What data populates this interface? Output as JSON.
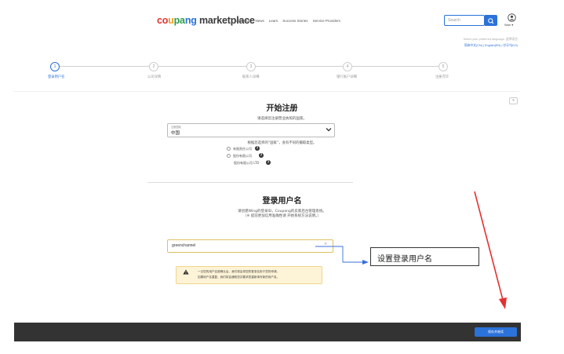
{
  "header": {
    "logo": {
      "c1": "co",
      "c2": "u",
      "c3": "pa",
      "c4": "ng",
      "rest": " marketplace"
    },
    "nav": [
      "About Us",
      "News",
      "Learn",
      "Success Stories",
      "Service Providers"
    ],
    "search_placeholder": "Search",
    "user_label": "Wan ▾",
    "lang_note": "Select your preferred language. 选择语言",
    "lang_links": "简体中文(CN) | English(EN) | 한국어(KO)"
  },
  "stepper": {
    "steps": [
      {
        "num": "1",
        "label": "登录用户名",
        "active": true
      },
      {
        "num": "2",
        "label": "公司详情",
        "active": false
      },
      {
        "num": "3",
        "label": "联系人详细",
        "active": false
      },
      {
        "num": "4",
        "label": "银行账户详细",
        "active": false
      },
      {
        "num": "5",
        "label": "注册完毕",
        "active": false
      }
    ]
  },
  "collapse": "»",
  "start": {
    "title": "开始注册",
    "subtitle": "请选择您注册营业执照的国家。",
    "country_label": "注册国家",
    "country_value": "中国",
    "biz_note": "根据您选择的“国家”，会有不同的摄取类型。",
    "options": [
      "有限责任公司",
      "股份有限公司",
      "股份有限公司 LTD"
    ]
  },
  "login": {
    "title": "登录用户名",
    "sub1": "请创建Wing的登录ID，Coupang的卖家后台管理系统。",
    "sub2": "（※ 提前更加信用准确性请 开始系统方法说明。）",
    "username_value": "greenchannel",
    "clear": "×",
    "warn1": "一旦您的用户名被确认后，我们将会将您的登录名用于您的申请。",
    "warn2": "如果用户名重复，我们将会通知您并要求您重新填写新的用户名。"
  },
  "annotation": "设置登录用户名",
  "footer": {
    "button": "保存并继续"
  },
  "colors": {
    "accent": "#2b72d9",
    "annotation_arrow_red": "#e53030",
    "annotation_arrow_blue": "#3a6fd8",
    "warning_bg": "#fdf3d6"
  }
}
